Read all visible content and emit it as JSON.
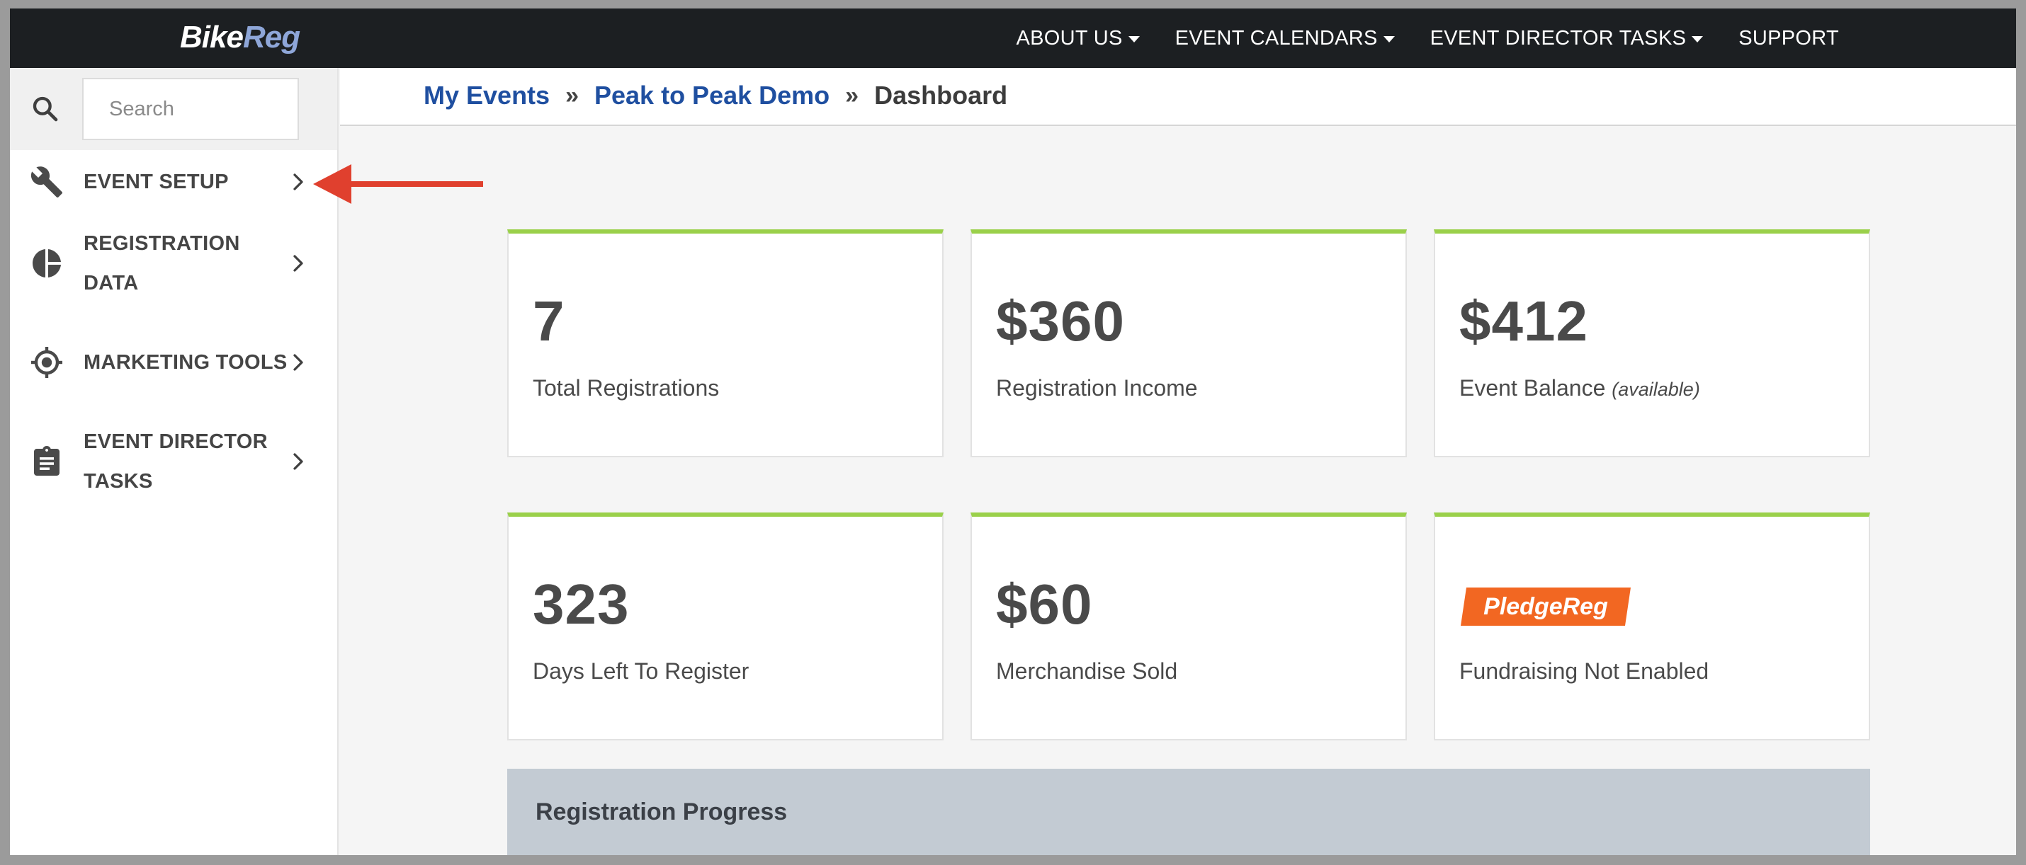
{
  "logo": {
    "part1": "Bike",
    "part2": "Reg"
  },
  "topnav": {
    "items": [
      {
        "label": "ABOUT US",
        "dropdown": true
      },
      {
        "label": "EVENT CALENDARS",
        "dropdown": true
      },
      {
        "label": "EVENT DIRECTOR TASKS",
        "dropdown": true
      },
      {
        "label": "SUPPORT",
        "dropdown": false
      }
    ]
  },
  "sidebar": {
    "search_placeholder": "Search",
    "items": [
      {
        "label": "EVENT SETUP",
        "icon": "wrench-icon"
      },
      {
        "label": "REGISTRATION DATA",
        "icon": "pie-chart-icon"
      },
      {
        "label": "MARKETING TOOLS",
        "icon": "target-icon"
      },
      {
        "label": "EVENT DIRECTOR TASKS",
        "icon": "clipboard-icon"
      }
    ]
  },
  "breadcrumb": {
    "link1": "My Events",
    "sep": "»",
    "link2": "Peak to Peak Demo",
    "current": "Dashboard"
  },
  "cards": {
    "total_registrations": {
      "value": "7",
      "caption": "Total Registrations"
    },
    "registration_income": {
      "value": "$360",
      "caption": "Registration Income"
    },
    "event_balance": {
      "value": "$412",
      "caption": "Event Balance",
      "note": "(available)"
    },
    "days_left": {
      "value": "323",
      "caption": "Days Left To Register"
    },
    "merchandise": {
      "value": "$60",
      "caption": "Merchandise Sold"
    },
    "fundraising": {
      "logo_text": "PledgeReg",
      "caption": "Fundraising Not Enabled"
    }
  },
  "progress": {
    "title": "Registration Progress"
  },
  "colors": {
    "nav_bg": "#1c1f22",
    "link_blue": "#1f4fa0",
    "card_accent": "#9ad04a",
    "arrow_red": "#e0402e",
    "pledge_orange": "#f26722"
  }
}
